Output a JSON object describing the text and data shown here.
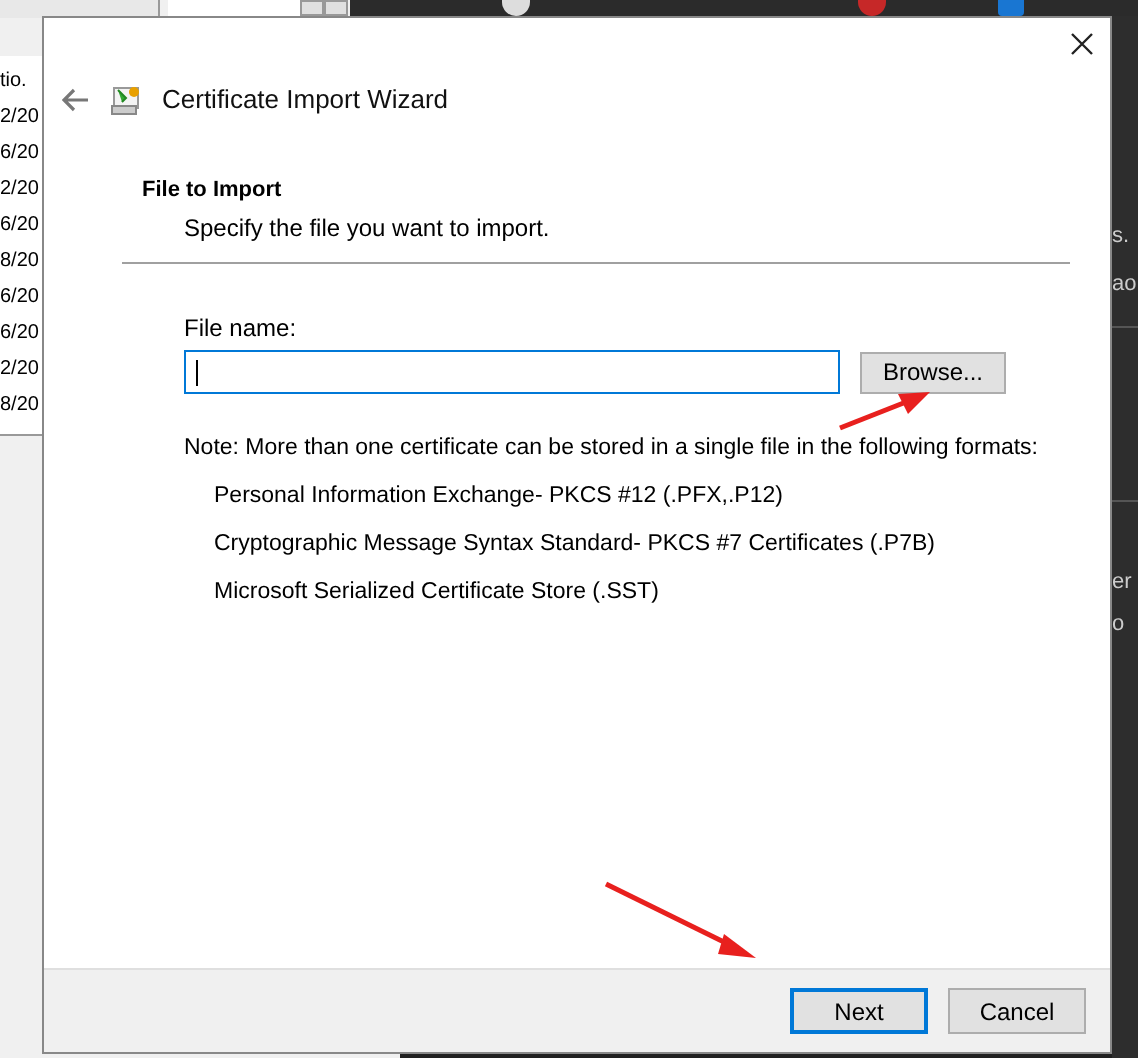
{
  "background_window": {
    "rows": [
      "tio.",
      "2/20",
      "6/20",
      "2/20",
      "6/20",
      "8/20",
      "6/20",
      "6/20",
      "2/20",
      "8/20"
    ]
  },
  "background_panel": {
    "texts": [
      "s.",
      "ao",
      "er",
      "o"
    ]
  },
  "dialog": {
    "title": "Certificate Import Wizard",
    "heading": "File to Import",
    "subheading": "Specify the file you want to import.",
    "file_label": "File name:",
    "browse_button": "Browse...",
    "note": "Note:  More than one certificate can be stored in a single file in the following formats:",
    "formats": [
      "Personal Information Exchange- PKCS #12 (.PFX,.P12)",
      "Cryptographic Message Syntax Standard- PKCS #7 Certificates (.P7B)",
      "Microsoft Serialized Certificate Store (.SST)"
    ],
    "buttons": [
      {
        "label": "Next",
        "selected": true
      },
      {
        "label": "Cancel",
        "selected": false
      }
    ]
  }
}
